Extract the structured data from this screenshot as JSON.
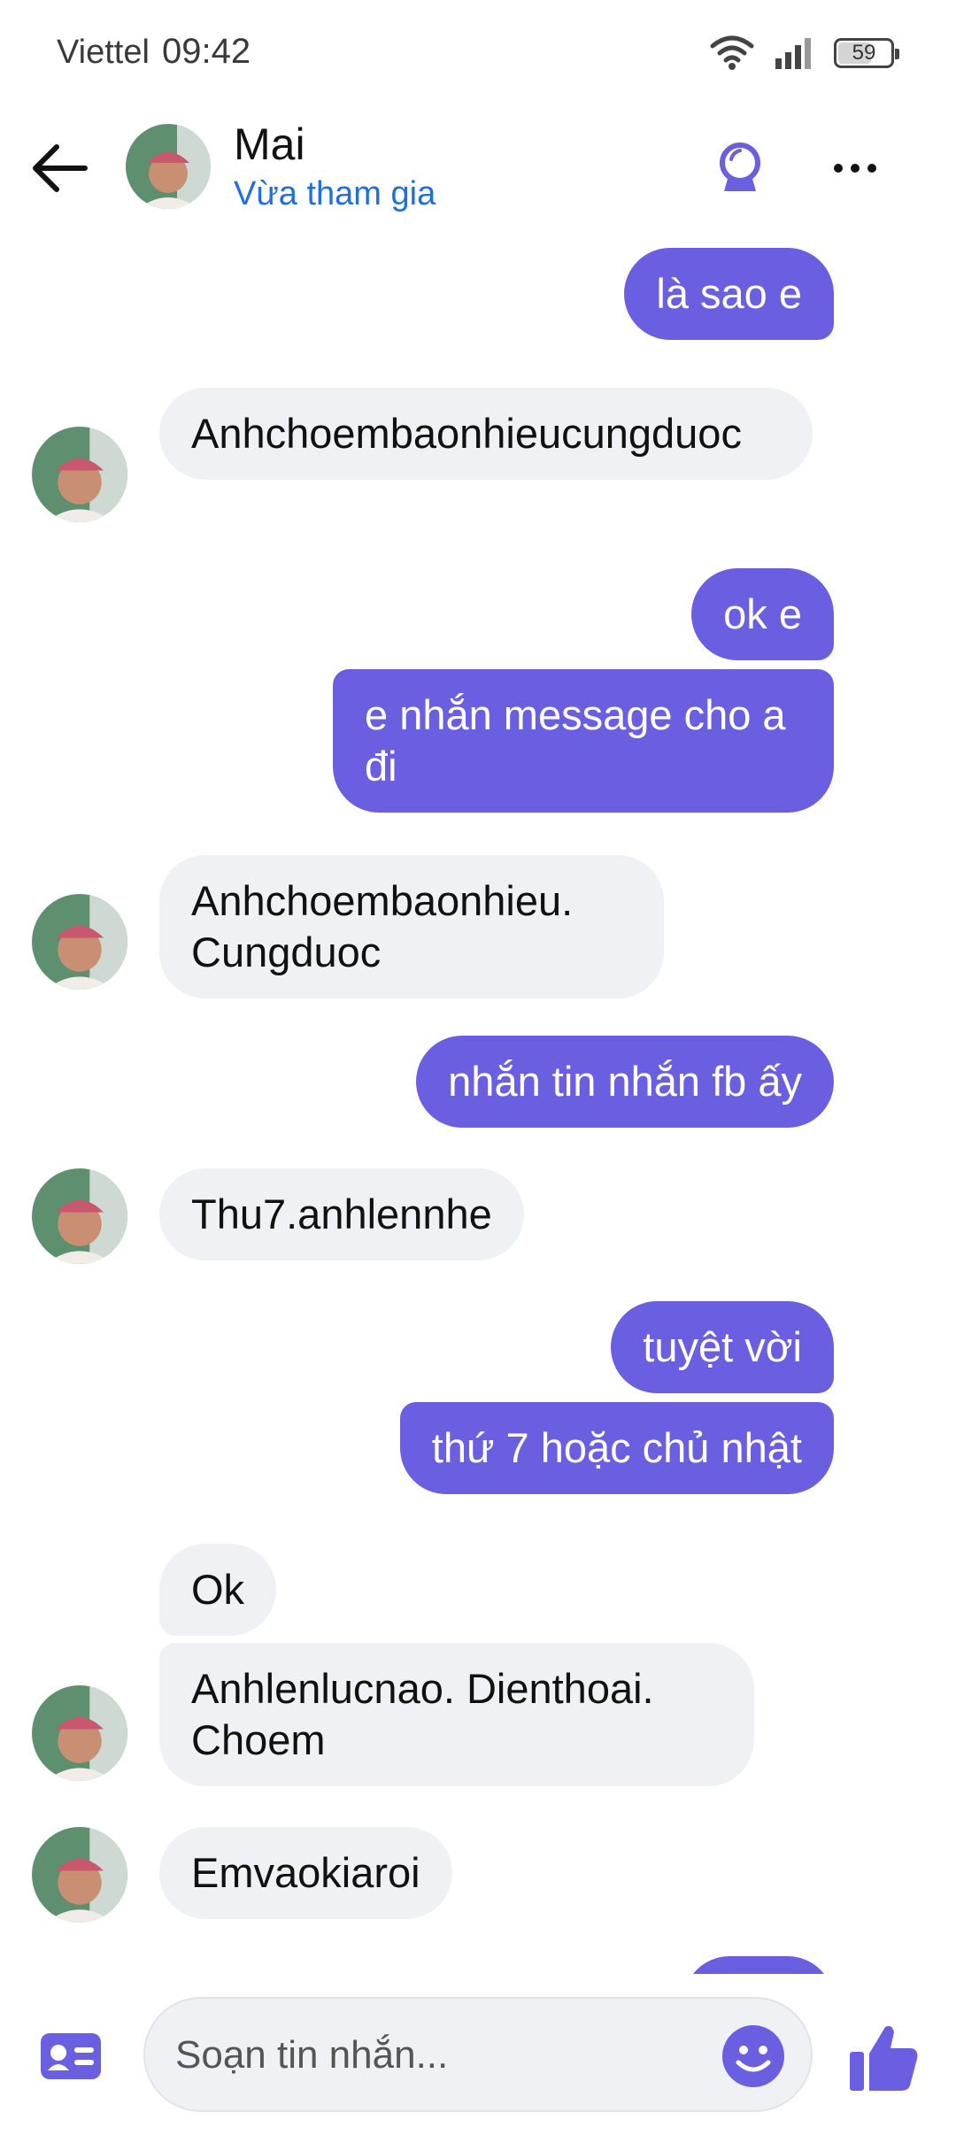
{
  "status_bar": {
    "carrier": "Viettel",
    "time": "09:42",
    "battery": "59"
  },
  "header": {
    "name": "Mai",
    "status": "Vừa tham gia"
  },
  "messages": [
    {
      "side": "out",
      "text": "là sao e"
    },
    {
      "side": "in",
      "text": "Anhchoembaonhieucungduoc"
    },
    {
      "side": "out",
      "text": "ok e"
    },
    {
      "side": "out",
      "text": "e nhắn message cho a đi"
    },
    {
      "side": "in",
      "text": "Anhchoembaonhieu. Cungduoc"
    },
    {
      "side": "out",
      "text": "nhắn tin nhắn fb ấy"
    },
    {
      "side": "in",
      "text": "Thu7.anhlennhe"
    },
    {
      "side": "out",
      "text": "tuyệt vời"
    },
    {
      "side": "out",
      "text": "thứ 7 hoặc chủ nhật"
    },
    {
      "side": "in",
      "text": "Ok"
    },
    {
      "side": "in",
      "text": "Anhlenlucnao. Dienthoai. Choem"
    },
    {
      "side": "in",
      "text": "Emvaokiaroi"
    }
  ],
  "composer": {
    "placeholder": "Soạn tin nhắn..."
  },
  "colors": {
    "accent": "#6b5fe1",
    "incoming": "#f0f1f4",
    "link": "#1f6fe0"
  },
  "icons": [
    "back-arrow-icon",
    "crystal-ball-icon",
    "more-icon",
    "contact-card-icon",
    "emoji-icon",
    "thumbs-up-icon",
    "wifi-icon",
    "signal-icon",
    "battery-icon"
  ]
}
